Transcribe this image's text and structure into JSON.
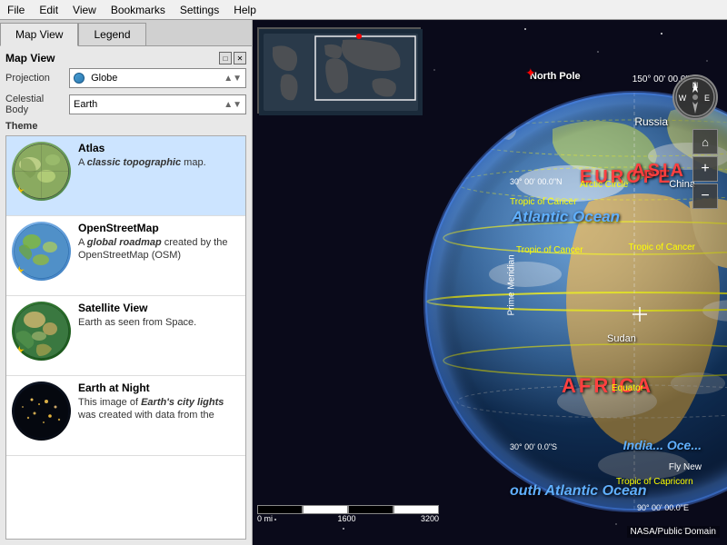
{
  "menubar": {
    "items": [
      "File",
      "Edit",
      "View",
      "Bookmarks",
      "Settings",
      "Help"
    ]
  },
  "tabs": {
    "items": [
      {
        "label": "Map View",
        "active": true
      },
      {
        "label": "Legend",
        "active": false
      }
    ]
  },
  "panel": {
    "mapview_label": "Map View",
    "projection_label": "Projection",
    "projection_value": "Globe",
    "celestial_body_label": "Celestial Body",
    "celestial_body_value": "Earth",
    "theme_label": "Theme"
  },
  "themes": [
    {
      "name": "Atlas",
      "desc_prefix": "A ",
      "desc_italic": "classic topographic",
      "desc_suffix": " map.",
      "starred": true,
      "thumb_class": "atlas-globe"
    },
    {
      "name": "OpenStreetMap",
      "desc_prefix": "A ",
      "desc_italic": "global roadmap",
      "desc_suffix": " created by the OpenStreetMap (OSM)",
      "starred": true,
      "thumb_class": "osm-globe"
    },
    {
      "name": "Satellite View",
      "desc_prefix": "",
      "desc_italic": "",
      "desc_suffix": "Earth as seen from Space.",
      "starred": true,
      "thumb_class": "sat-globe",
      "selected": true
    },
    {
      "name": "Earth at Night",
      "desc_prefix": "This image of ",
      "desc_italic": "Earth's city lights",
      "desc_suffix": " was created with data from the",
      "starred": false,
      "thumb_class": "night-globe"
    }
  ],
  "map": {
    "labels": {
      "europe": "EUROPE",
      "asia": "ASIA",
      "africa": "AFRICA",
      "north_pole": "North Pole",
      "russia": "Russia",
      "china": "China",
      "sudan": "Sudan",
      "arctic_circle": "Arctic Circle",
      "tropic_cancer": "Tropic of Cancer",
      "equator": "Equator",
      "tropic_capricorn": "Tropic of Capricorn",
      "prime_meridian": "Prime Meridian",
      "atlantic_ocean": "Atlantic Ocean",
      "indian_ocean": "India... Oce...",
      "south_atlantic": "outh Atlantic Ocean"
    },
    "coords": {
      "top_right": "150° 00' 00.0\"",
      "n30": "30° 00' 00.0\"N",
      "s30": "30° 00' 0.0\"S",
      "bottom_right": "90° 00' 00.0\"E"
    },
    "scale": {
      "labels": [
        "0 mi",
        "1600",
        "3200"
      ]
    },
    "attribution": "NASA/Public Domain"
  },
  "controls": {
    "zoom_in": "+",
    "zoom_out": "−",
    "home": "⌂"
  }
}
